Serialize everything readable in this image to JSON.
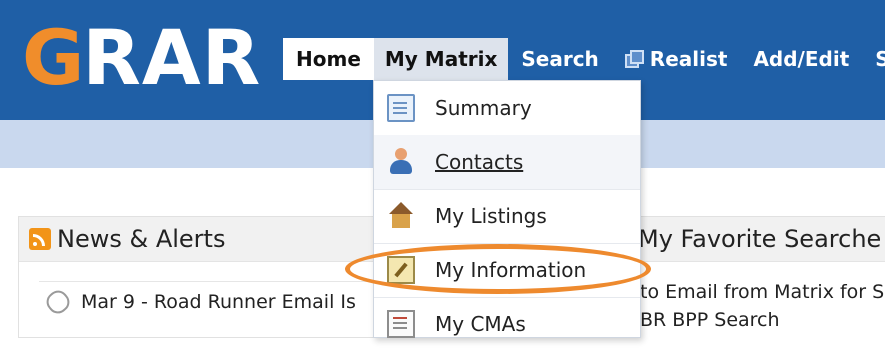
{
  "logo": {
    "g": "G",
    "rest": "RAR"
  },
  "nav": {
    "items": [
      {
        "label": "Home"
      },
      {
        "label": "My Matrix"
      },
      {
        "label": "Search"
      },
      {
        "label": "Realist"
      },
      {
        "label": "Add/Edit"
      },
      {
        "label": "S"
      }
    ]
  },
  "dropdown": {
    "items": [
      {
        "label": "Summary",
        "icon": "document-icon"
      },
      {
        "label": "Contacts",
        "icon": "person-icon"
      },
      {
        "label": "My Listings",
        "icon": "house-icon"
      },
      {
        "label": "My Information",
        "icon": "info-edit-icon"
      },
      {
        "label": "My CMAs",
        "icon": "cma-icon"
      }
    ]
  },
  "news": {
    "title": "News & Alerts",
    "items": [
      "Mar 9 - Road Runner Email Is"
    ]
  },
  "favorites": {
    "title": "My Favorite Searche",
    "lines": [
      "to Email from Matrix for S",
      "BR BPP Search"
    ]
  },
  "colors": {
    "header": "#1f5fa6",
    "subbar": "#c9d8ee",
    "logo_accent": "#f08d2b",
    "annotation": "#ee8a2e"
  }
}
